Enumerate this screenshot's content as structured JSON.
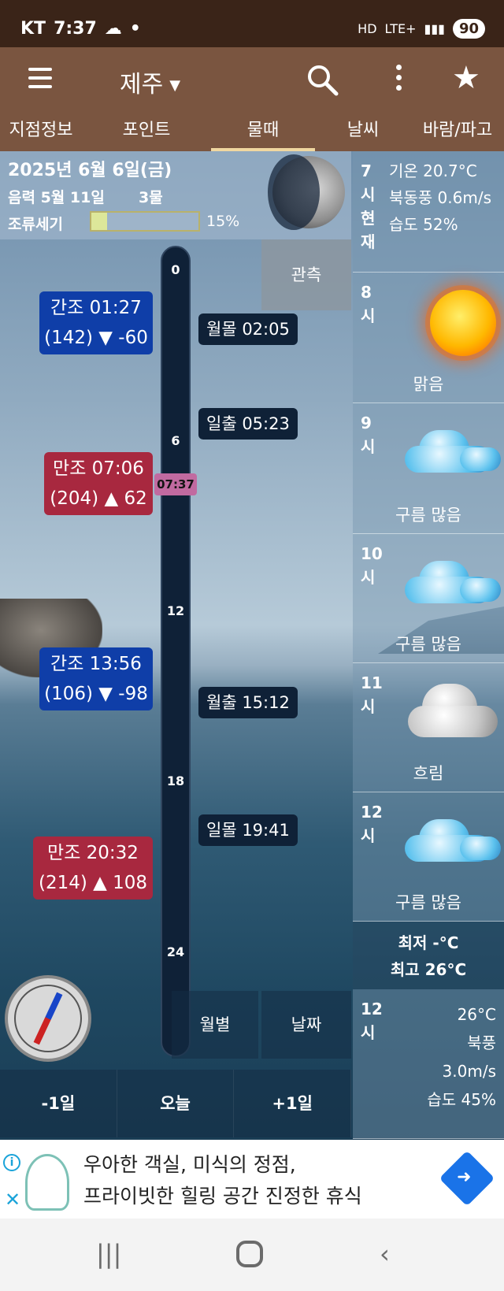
{
  "status": {
    "carrier": "KT",
    "time": "7:37",
    "network": "LTE+",
    "battery": "90"
  },
  "appbar": {
    "location": "제주"
  },
  "tabs": [
    "지점정보",
    "포인트",
    "물때",
    "날씨",
    "바람/파고"
  ],
  "date": {
    "full": "2025년 6월 6일(금)",
    "lunar": "음력 5월 11일",
    "tide_phase": "3물",
    "strength_label": "조류세기",
    "strength_pct": 15,
    "strength_text": "15%"
  },
  "timeline": {
    "hours": [
      "0",
      "6",
      "12",
      "18",
      "24"
    ],
    "now": "07:37"
  },
  "observe_label": "관측",
  "tides": [
    {
      "line1": "간조 01:27",
      "line2": "(142) ▼ -60"
    },
    {
      "line1": "만조 07:06",
      "line2": "(204) ▲ 62"
    },
    {
      "line1": "간조 13:56",
      "line2": "(106) ▼ -98"
    },
    {
      "line1": "만조 20:32",
      "line2": "(214) ▲ 108"
    }
  ],
  "events": [
    "월몰 02:05",
    "일출 05:23",
    "월출 15:12",
    "일몰 19:41"
  ],
  "current": {
    "hour_label": "7시현재",
    "temp": "기온 20.7°C",
    "wind": "북동풍 0.6m/s",
    "humidity": "습도 52%"
  },
  "forecast": [
    {
      "hour": "8시",
      "cond": "맑음",
      "icon": "sun-icon"
    },
    {
      "hour": "9시",
      "cond": "구름 많음",
      "icon": "cloud-icon"
    },
    {
      "hour": "10시",
      "cond": "구름 많음",
      "icon": "cloud-icon"
    },
    {
      "hour": "11시",
      "cond": "흐림",
      "icon": "overcast-icon"
    },
    {
      "hour": "12시",
      "cond": "구름 많음",
      "icon": "cloud-icon"
    }
  ],
  "minmax": {
    "min": "최저 -°C",
    "max": "최고 26°C"
  },
  "bottom_wx": {
    "hour": "12시",
    "temp": "26°C",
    "wind_dir": "북풍",
    "wind_speed": "3.0m/s",
    "humidity": "습도 45%"
  },
  "buttons": {
    "monthly": "월별",
    "date": "날짜",
    "prev": "-1일",
    "today": "오늘",
    "next": "+1일"
  },
  "ad": {
    "line1": "우아한 객실, 미식의 정점,",
    "line2": "프라이빗한 힐링 공간 진정한 휴식"
  }
}
